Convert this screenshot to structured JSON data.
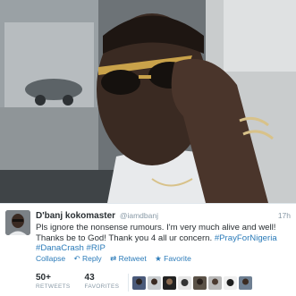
{
  "tweet": {
    "name": "D'banj kokomaster",
    "handle": "@iamdbanj",
    "time": "17h",
    "text_line1": "Pls ignore the nonsense rumours. I'm very much alive and well!",
    "text_line2_plain": "Thanks be to God! Thank you 4 all ur concern. ",
    "hashtag1": "#PrayForNigeria",
    "hashtag2": "#DanaCrash",
    "hashtag3": "#RIP"
  },
  "actions": {
    "collapse": "Collapse",
    "reply": "Reply",
    "retweet": "Retweet",
    "favorite": "Favorite"
  },
  "stats": {
    "retweets_count": "50+",
    "retweets_label": "RETWEETS",
    "favorites_count": "43",
    "favorites_label": "FAVORITES"
  },
  "icons": [
    "reply-icon",
    "retweet-icon",
    "favorite-icon"
  ],
  "colors": {
    "link": "#2b7bb9",
    "text": "#292f33",
    "muted": "#8899a6"
  }
}
